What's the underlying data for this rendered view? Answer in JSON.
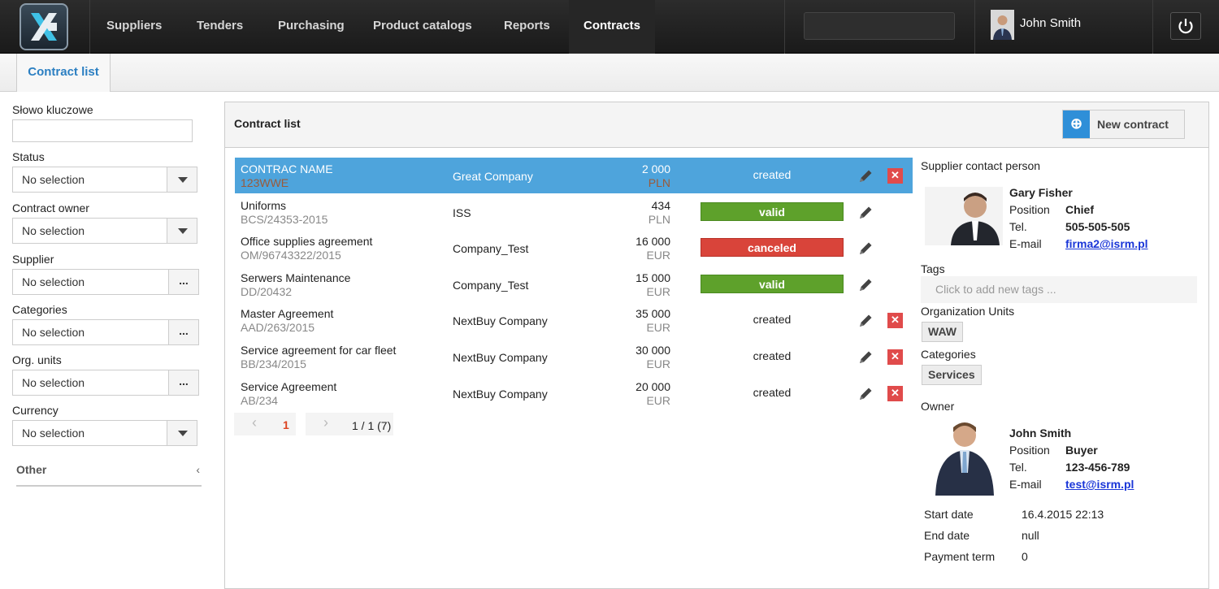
{
  "nav": {
    "items": [
      "Suppliers",
      "Tenders",
      "Purchasing",
      "Product catalogs",
      "Reports",
      "Contracts"
    ],
    "active": "Contracts",
    "user_name": "John Smith"
  },
  "tabs": {
    "contract_list": "Contract list"
  },
  "filters": {
    "keyword_label": "Słowo kluczowe",
    "keyword_value": "",
    "status_label": "Status",
    "status_value": "No selection",
    "owner_label": "Contract owner",
    "owner_value": "No selection",
    "supplier_label": "Supplier",
    "supplier_value": "No selection",
    "categories_label": "Categories",
    "categories_value": "No selection",
    "org_units_label": "Org. units",
    "org_units_value": "No selection",
    "currency_label": "Currency",
    "currency_value": "No selection",
    "dots": "...",
    "other_label": "Other"
  },
  "panel": {
    "title": "Contract list",
    "new_button": "New contract"
  },
  "contracts": [
    {
      "name": "CONTRAC NAME",
      "code": "123WWE",
      "company": "Great Company",
      "amount": "2 000",
      "currency": "PLN",
      "status": "created",
      "deletable": true
    },
    {
      "name": "Uniforms",
      "code": "BCS/24353-2015",
      "company": "ISS",
      "amount": "434",
      "currency": "PLN",
      "status": "valid",
      "deletable": false
    },
    {
      "name": "Office supplies agreement",
      "code": "OM/96743322/2015",
      "company": "Company_Test",
      "amount": "16 000",
      "currency": "EUR",
      "status": "canceled",
      "deletable": false
    },
    {
      "name": "Serwers Maintenance",
      "code": "DD/20432",
      "company": "Company_Test",
      "amount": "15 000",
      "currency": "EUR",
      "status": "valid",
      "deletable": false
    },
    {
      "name": "Master Agreement",
      "code": "AAD/263/2015",
      "company": "NextBuy Company",
      "amount": "35 000",
      "currency": "EUR",
      "status": "created",
      "deletable": true
    },
    {
      "name": "Service agreement for car fleet",
      "code": "BB/234/2015",
      "company": "NextBuy Company",
      "amount": "30 000",
      "currency": "EUR",
      "status": "created",
      "deletable": true
    },
    {
      "name": "Service Agreement",
      "code": "AB/234",
      "company": "NextBuy Company",
      "amount": "20 000",
      "currency": "EUR",
      "status": "created",
      "deletable": true
    }
  ],
  "pager": {
    "current": "1",
    "summary": "1 / 1 (7)"
  },
  "details": {
    "supplier_contact_label": "Supplier contact person",
    "contact": {
      "name": "Gary Fisher",
      "position_label": "Position",
      "position": "Chief",
      "tel_label": "Tel.",
      "tel": "505-505-505",
      "email_label": "E-mail",
      "email": "firma2@isrm.pl"
    },
    "tags_label": "Tags",
    "tags_placeholder": "Click to add new tags ...",
    "org_units_label": "Organization Units",
    "org_unit": "WAW",
    "categories_label": "Categories",
    "category": "Services",
    "owner_label": "Owner",
    "owner": {
      "name": "John Smith",
      "position_label": "Position",
      "position": "Buyer",
      "tel_label": "Tel.",
      "tel": "123-456-789",
      "email_label": "E-mail",
      "email": "test@isrm.pl"
    },
    "start_date_label": "Start date",
    "start_date": "16.4.2015 22:13",
    "end_date_label": "End date",
    "end_date": "null",
    "payment_term_label": "Payment term",
    "payment_term": "0"
  },
  "colors": {
    "selected_row": "#4ea4dc",
    "valid": "#5ea12b",
    "canceled": "#d9443a",
    "accent": "#2b7fc2"
  }
}
